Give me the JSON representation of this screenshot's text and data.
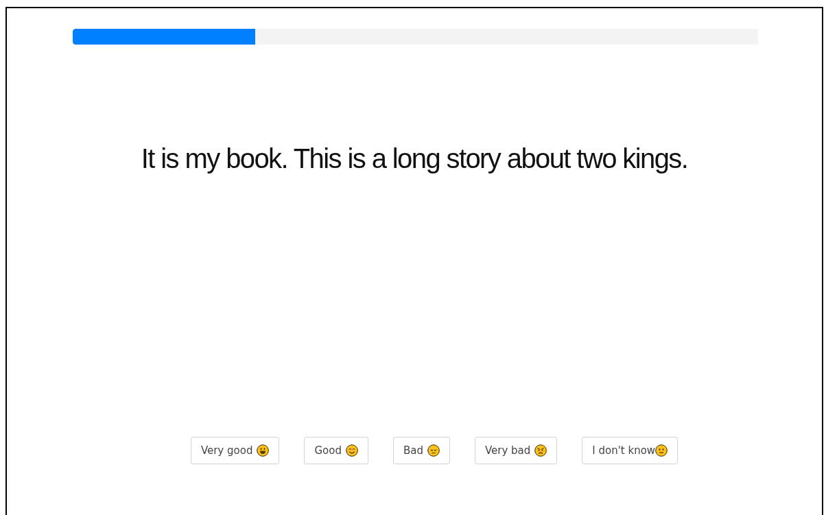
{
  "progress": {
    "level": 0.267
  },
  "sentence": "It is my book. This is a long story about two kings.",
  "answers": [
    {
      "label": "Very good",
      "kind": "grin"
    },
    {
      "label": "Good",
      "kind": "smile"
    },
    {
      "label": "Bad",
      "kind": "sad"
    },
    {
      "label": "Very bad",
      "kind": "angry"
    },
    {
      "label": "I don't know",
      "kind": "neutral"
    }
  ]
}
